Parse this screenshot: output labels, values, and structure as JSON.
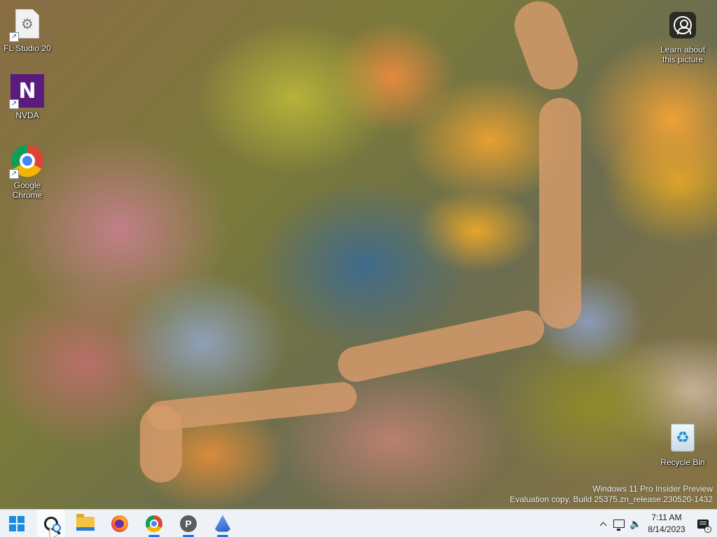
{
  "desktop": {
    "icons": [
      {
        "label": "FL Studio 20",
        "icon": "fl-studio-icon",
        "shortcut": true
      },
      {
        "label": "NVDA",
        "icon": "nvda-icon",
        "shortcut": true
      },
      {
        "label": "Google Chrome",
        "icon": "chrome-icon",
        "shortcut": true
      },
      {
        "label": "Learn about this picture",
        "icon": "camera-icon",
        "shortcut": false
      },
      {
        "label": "Recycle Bin",
        "icon": "recycle-bin-icon",
        "shortcut": false
      }
    ],
    "nvda_glyph": "N",
    "recycle_glyph": "♻",
    "shortcut_glyph": "↗",
    "watermark": {
      "line1": "Windows 11 Pro Insider Preview",
      "line2": "Evaluation copy. Build 25375.zn_release.230520-1432"
    }
  },
  "taskbar": {
    "buttons": [
      {
        "name": "start-button",
        "icon": "windows-logo-icon"
      },
      {
        "name": "search-button",
        "icon": "search-icon"
      },
      {
        "name": "file-explorer-button",
        "icon": "folder-icon"
      },
      {
        "name": "firefox-button",
        "icon": "firefox-icon"
      },
      {
        "name": "chrome-button",
        "icon": "chrome-icon"
      },
      {
        "name": "p-app-button",
        "icon": "p-app-icon",
        "glyph": "P"
      },
      {
        "name": "shell-app-button",
        "icon": "shell-icon"
      }
    ],
    "tray": {
      "volume_glyph": "🔈",
      "time": "7:11 AM",
      "date": "8/14/2023",
      "notification_badge": "1"
    }
  },
  "colors": {
    "taskbar_bg": "#eef1f5",
    "accent": "#1a73e8",
    "windows_blue": "#1a8ce0"
  }
}
